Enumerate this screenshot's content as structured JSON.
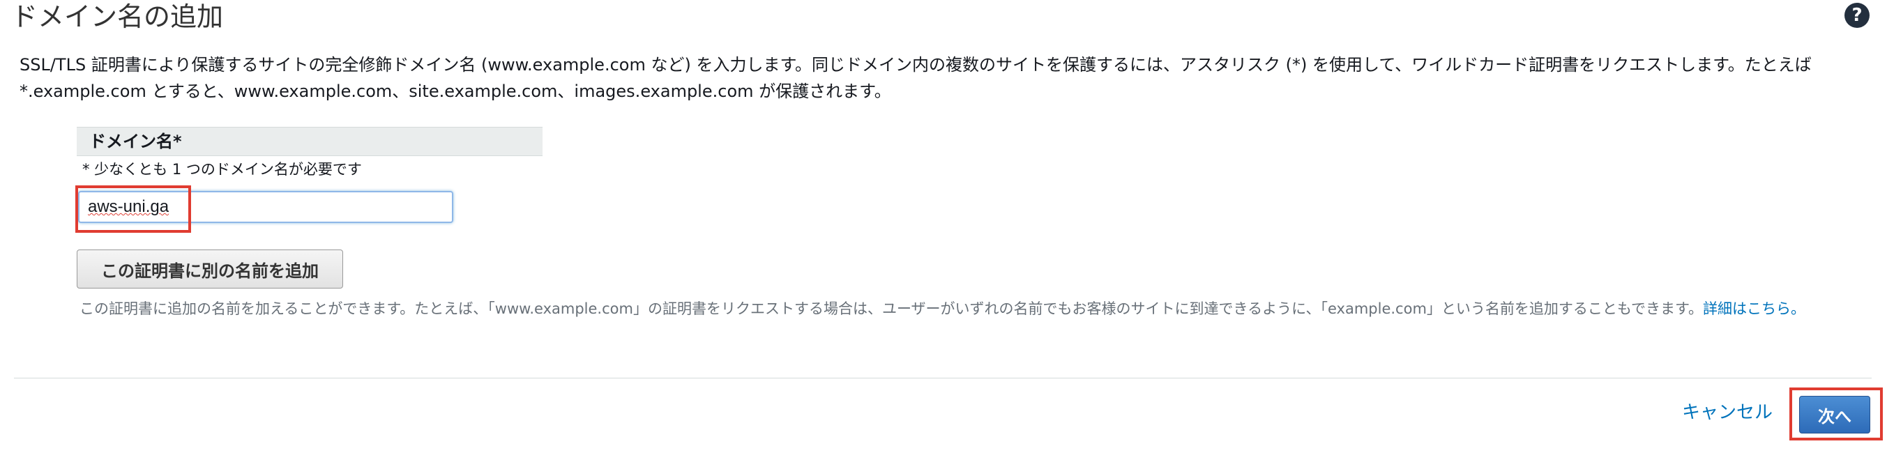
{
  "header": {
    "title": "ドメイン名の追加",
    "help_icon": "question-circle-icon"
  },
  "description": "SSL/TLS 証明書により保護するサイトの完全修飾ドメイン名 (www.example.com など) を入力します。同じドメイン内の複数のサイトを保護するには、アスタリスク (*) を使用して、ワイルドカード証明書をリクエストします。たとえば *.example.com とすると、www.example.com、site.example.com、images.example.com が保護されます。",
  "domain_section": {
    "header_label": "ドメイン名*",
    "required_note": "* 少なくとも 1 つのドメイン名が必要です",
    "input_value": "aws-uni.ga",
    "add_name_button": "この証明書に別の名前を追加",
    "helper_text": "この証明書に追加の名前を加えることができます。たとえば、「www.example.com」の証明書をリクエストする場合は、ユーザーがいずれの名前でもお客様のサイトに到達できるように、「example.com」という名前を追加することもできます。",
    "helper_link": "詳細はこちら。"
  },
  "footer": {
    "cancel_label": "キャンセル",
    "next_label": "次へ"
  },
  "colors": {
    "highlight": "#e03c31",
    "primary_button": "#2d6bb8",
    "link": "#0073bb"
  }
}
